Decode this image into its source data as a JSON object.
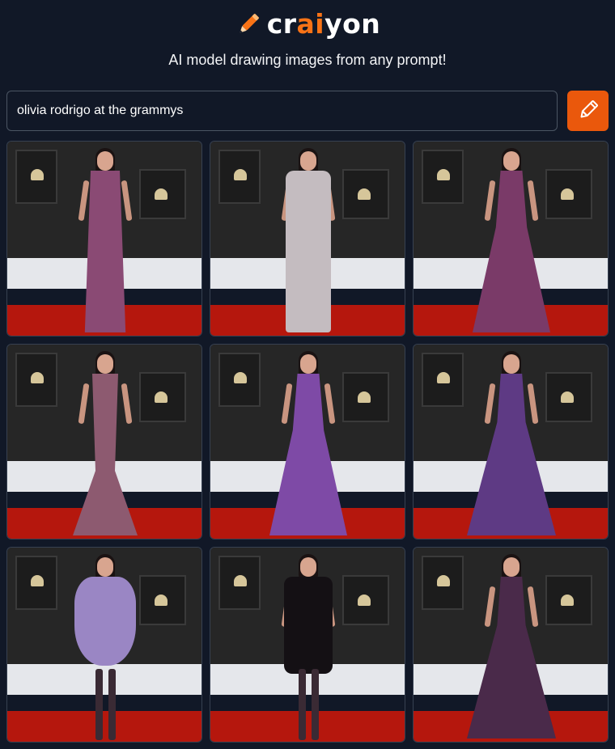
{
  "brand": {
    "icon": "pencil-icon",
    "name_prefix": "cr",
    "name_accent": "ai",
    "name_suffix": "yon",
    "accent_color": "#f97316"
  },
  "tagline": "AI model drawing images from any prompt!",
  "search": {
    "value": "olivia rodrigo at the grammys"
  },
  "draw_button": {
    "icon": "pencil-icon",
    "color": "#ea580c"
  },
  "results": [
    {
      "dress_color": "#8a4a74",
      "style": "plaid-gown"
    },
    {
      "dress_color": "#c4bcc0",
      "style": "feather-jumpsuit"
    },
    {
      "dress_color": "#7a3a68",
      "style": "feather-hi-lo"
    },
    {
      "dress_color": "#8d5a70",
      "style": "feather-mermaid"
    },
    {
      "dress_color": "#7e4aa6",
      "style": "feather-train"
    },
    {
      "dress_color": "#5e3a84",
      "style": "satin-ballgown"
    },
    {
      "dress_color": "#9a86c4",
      "style": "feather-mini"
    },
    {
      "dress_color": "#141014",
      "style": "black-sequin"
    },
    {
      "dress_color": "#4a2a4a",
      "style": "ruffle-gown"
    }
  ]
}
